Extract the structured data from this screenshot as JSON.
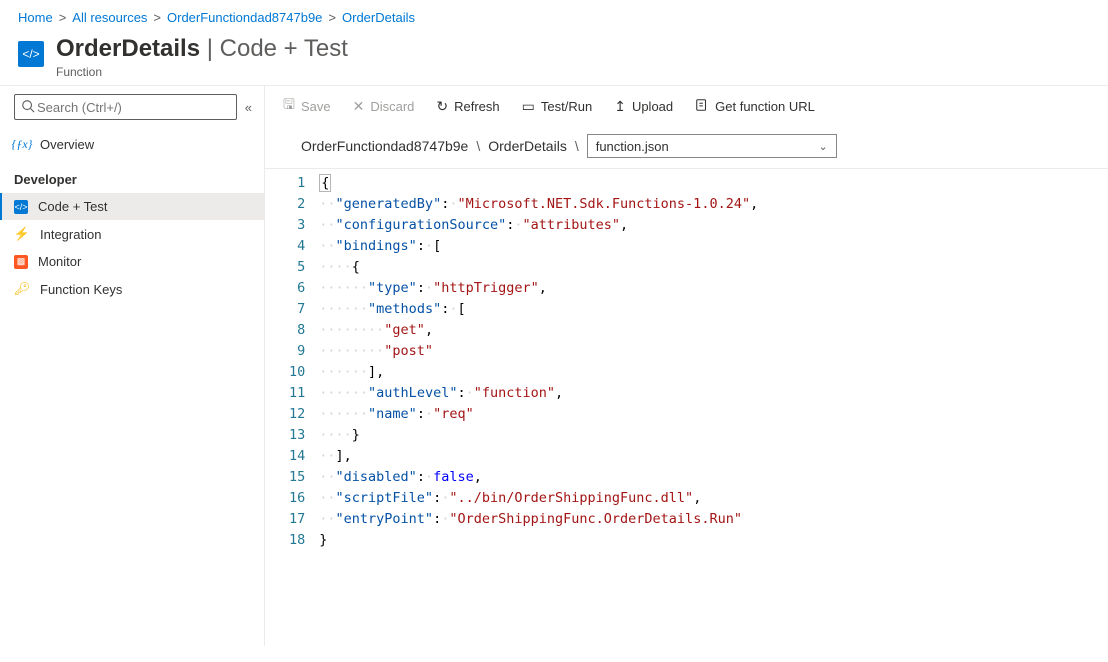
{
  "breadcrumb": [
    {
      "label": "Home"
    },
    {
      "label": "All resources"
    },
    {
      "label": "OrderFunctiondad8747b9e"
    },
    {
      "label": "OrderDetails"
    }
  ],
  "title": {
    "main": "OrderDetails",
    "section": "Code + Test",
    "subtitle": "Function"
  },
  "search": {
    "placeholder": "Search (Ctrl+/)"
  },
  "sidebar": {
    "items": [
      {
        "id": "overview",
        "label": "Overview"
      }
    ],
    "developer_header": "Developer",
    "dev_items": [
      {
        "id": "code-test",
        "label": "Code + Test"
      },
      {
        "id": "integration",
        "label": "Integration"
      },
      {
        "id": "monitor",
        "label": "Monitor"
      },
      {
        "id": "function-keys",
        "label": "Function Keys"
      }
    ]
  },
  "toolbar": {
    "save": "Save",
    "discard": "Discard",
    "refresh": "Refresh",
    "testrun": "Test/Run",
    "upload": "Upload",
    "geturl": "Get function URL"
  },
  "pathbar": {
    "seg1": "OrderFunctiondad8747b9e",
    "seg2": "OrderDetails",
    "file": "function.json"
  },
  "code": {
    "generatedBy_k": "\"generatedBy\"",
    "generatedBy_v": "\"Microsoft.NET.Sdk.Functions-1.0.24\"",
    "configurationSource_k": "\"configurationSource\"",
    "configurationSource_v": "\"attributes\"",
    "bindings_k": "\"bindings\"",
    "type_k": "\"type\"",
    "type_v": "\"httpTrigger\"",
    "methods_k": "\"methods\"",
    "get_v": "\"get\"",
    "post_v": "\"post\"",
    "authLevel_k": "\"authLevel\"",
    "authLevel_v": "\"function\"",
    "name_k": "\"name\"",
    "name_v": "\"req\"",
    "disabled_k": "\"disabled\"",
    "disabled_v": "false",
    "scriptFile_k": "\"scriptFile\"",
    "scriptFile_v": "\"../bin/OrderShippingFunc.dll\"",
    "entryPoint_k": "\"entryPoint\"",
    "entryPoint_v": "\"OrderShippingFunc.OrderDetails.Run\""
  }
}
